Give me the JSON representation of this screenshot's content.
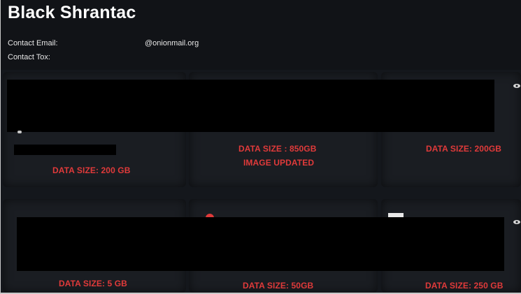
{
  "header": {
    "title": "Black Shrantac",
    "contact_email_label": "Contact Email:",
    "contact_email_value": "@onionmail.org",
    "contact_tox_label": "Contact Tox:"
  },
  "cards": [
    {
      "size_label": "DATA SIZE: 200 GB"
    },
    {
      "size_label": "DATA SIZE : 850GB",
      "status_label": "IMAGE UPDATED"
    },
    {
      "size_label": "DATA SIZE: 200GB"
    },
    {
      "size_label": "DATA SIZE: 5 GB"
    },
    {
      "size_label": "DATA SIZE: 50GB"
    },
    {
      "size_label": "DATA SIZE: 250 GB"
    }
  ],
  "colors": {
    "background": "#14171c",
    "accent_red": "#e03a3a",
    "text": "#ffffff"
  },
  "icons": [
    "eye-icon"
  ]
}
